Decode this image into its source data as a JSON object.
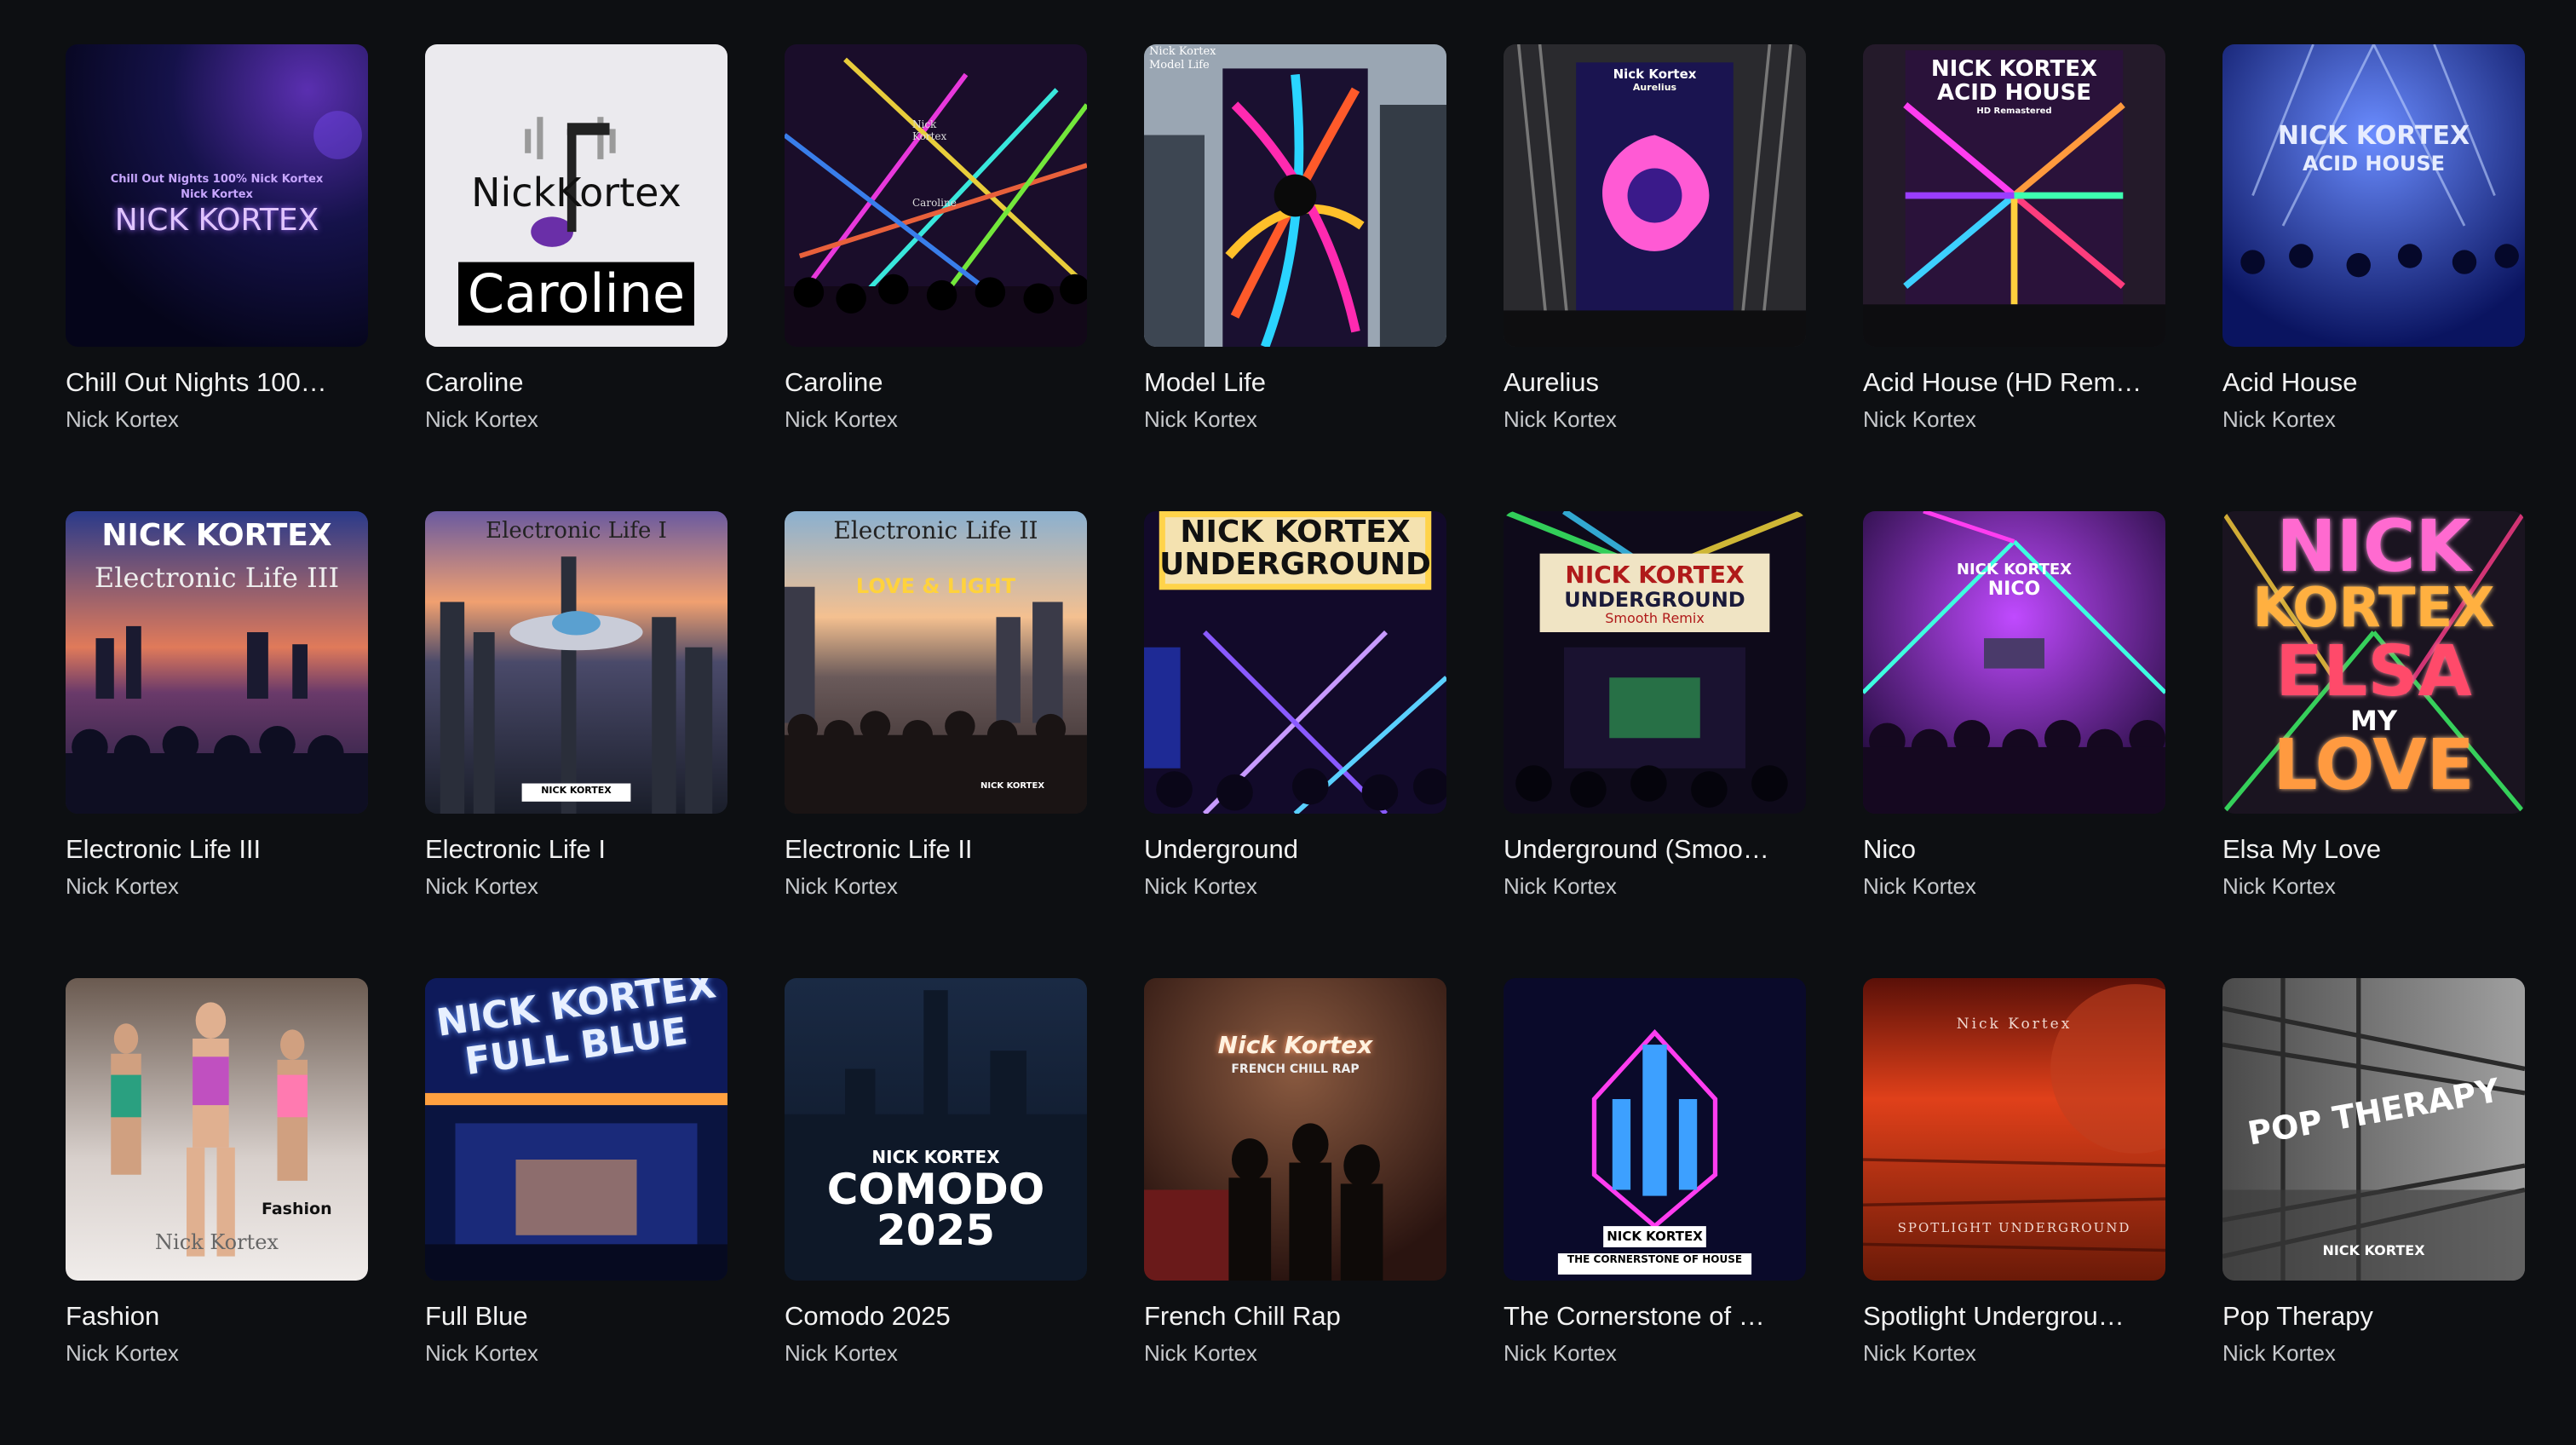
{
  "albums": [
    {
      "title": "Chill Out Nights 100…",
      "artist": "Nick Kortex",
      "icon": "album-cover-image"
    },
    {
      "title": "Caroline",
      "artist": "Nick Kortex",
      "icon": "album-cover-image"
    },
    {
      "title": "Caroline",
      "artist": "Nick Kortex",
      "icon": "album-cover-image"
    },
    {
      "title": "Model Life",
      "artist": "Nick Kortex",
      "icon": "album-cover-image"
    },
    {
      "title": "Aurelius",
      "artist": "Nick Kortex",
      "icon": "album-cover-image"
    },
    {
      "title": "Acid House (HD Rem…",
      "artist": "Nick Kortex",
      "icon": "album-cover-image"
    },
    {
      "title": "Acid House",
      "artist": "Nick Kortex",
      "icon": "album-cover-image"
    },
    {
      "title": "Electronic Life III",
      "artist": "Nick Kortex",
      "icon": "album-cover-image"
    },
    {
      "title": "Electronic Life I",
      "artist": "Nick Kortex",
      "icon": "album-cover-image"
    },
    {
      "title": "Electronic Life II",
      "artist": "Nick Kortex",
      "icon": "album-cover-image"
    },
    {
      "title": "Underground",
      "artist": "Nick Kortex",
      "icon": "album-cover-image"
    },
    {
      "title": "Underground (Smoo…",
      "artist": "Nick Kortex",
      "icon": "album-cover-image"
    },
    {
      "title": "Nico",
      "artist": "Nick Kortex",
      "icon": "album-cover-image"
    },
    {
      "title": "Elsa My Love",
      "artist": "Nick Kortex",
      "icon": "album-cover-image"
    },
    {
      "title": "Fashion",
      "artist": "Nick Kortex",
      "icon": "album-cover-image"
    },
    {
      "title": "Full Blue",
      "artist": "Nick Kortex",
      "icon": "album-cover-image"
    },
    {
      "title": "Comodo 2025",
      "artist": "Nick Kortex",
      "icon": "album-cover-image"
    },
    {
      "title": "French Chill Rap",
      "artist": "Nick Kortex",
      "icon": "album-cover-image"
    },
    {
      "title": "The Cornerstone of …",
      "artist": "Nick Kortex",
      "icon": "album-cover-image"
    },
    {
      "title": "Spotlight Undergrou…",
      "artist": "Nick Kortex",
      "icon": "album-cover-image"
    },
    {
      "title": "Pop Therapy",
      "artist": "Nick Kortex",
      "icon": "album-cover-image"
    }
  ],
  "covers": {
    "c0": {
      "line1": "Chill Out Nights 100% Nick Kortex",
      "line2": "Nick Kortex",
      "line3": "NICK KORTEX"
    },
    "c1": {
      "logo": "NickKortex",
      "label": "Caroline"
    },
    "c2": {
      "line1": "Nick",
      "line2": "Kortex",
      "line3": "Caroline"
    },
    "c3": {
      "line1": "Nick Kortex",
      "line2": "Model Life"
    },
    "c4": {
      "line1": "Nick Kortex",
      "line2": "Aurelius"
    },
    "c5": {
      "line1": "NICK KORTEX",
      "line2": "ACID HOUSE",
      "line3": "HD Remastered"
    },
    "c6": {
      "line1": "NICK KORTEX",
      "line2": "ACID HOUSE"
    },
    "c7": {
      "line1": "NICK KORTEX",
      "line2": "Electronic Life III"
    },
    "c8": {
      "line1": "Electronic Life I",
      "line2": "NICK KORTEX"
    },
    "c9": {
      "line1": "Electronic Life II",
      "line2": "LOVE & LIGHT",
      "line3": "NICK KORTEX"
    },
    "c10": {
      "line1": "NICK KORTEX",
      "line2": "UNDERGROUND"
    },
    "c11": {
      "line1": "NICK KORTEX",
      "line2": "UNDERGROUND",
      "line3": "Smooth Remix"
    },
    "c12": {
      "line1": "NICK KORTEX",
      "line2": "NICO"
    },
    "c13": {
      "line1": "NICK",
      "line2": "KORTEX",
      "line3": "ELSA",
      "line4": "MY",
      "line5": "LOVE"
    },
    "c14": {
      "line1": "Fashion",
      "line2": "Nick Kortex"
    },
    "c15": {
      "line1": "NICK KORTEX",
      "line2": "FULL BLUE"
    },
    "c16": {
      "line1": "NICK KORTEX",
      "line2": "COMODO",
      "line3": "2025"
    },
    "c17": {
      "line1": "Nick Kortex",
      "line2": "FRENCH CHILL RAP"
    },
    "c18": {
      "line1": "NICK KORTEX",
      "line2": "THE CORNERSTONE OF HOUSE"
    },
    "c19": {
      "line1": "Nick Kortex",
      "line2": "SPOTLIGHT UNDERGROUND"
    },
    "c20": {
      "line1": "POP THERAPY",
      "line2": "NICK KORTEX"
    }
  },
  "colors": {
    "background": "#0d0f12",
    "title": "#f2f2f2",
    "artist": "#c7c9cc"
  }
}
